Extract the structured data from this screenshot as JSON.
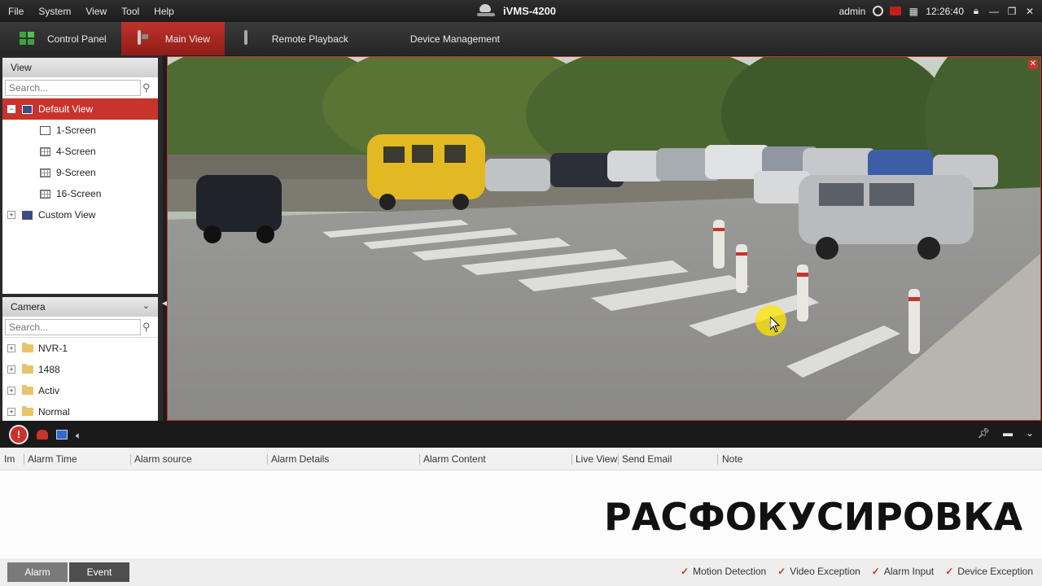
{
  "menu": {
    "items": [
      "File",
      "System",
      "View",
      "Tool",
      "Help"
    ]
  },
  "app": {
    "title": "iVMS-4200"
  },
  "tray": {
    "user": "admin",
    "time": "12:26:40"
  },
  "tabs": [
    {
      "label": "Control Panel",
      "icon": "control-panel-icon",
      "active": false
    },
    {
      "label": "Main View",
      "icon": "main-view-icon",
      "active": true
    },
    {
      "label": "Remote Playback",
      "icon": "remote-playback-icon",
      "active": false
    },
    {
      "label": "Device Management",
      "icon": "device-management-icon",
      "active": false
    }
  ],
  "view_panel": {
    "title": "View",
    "search_placeholder": "Search...",
    "tree": {
      "default_view": "Default View",
      "children": [
        "1-Screen",
        "4-Screen",
        "9-Screen",
        "16-Screen"
      ],
      "custom_view": "Custom View"
    }
  },
  "camera_panel": {
    "title": "Camera",
    "search_placeholder": "Search...",
    "items": [
      "NVR-1",
      "1488",
      "Activ",
      "Normal"
    ]
  },
  "alarm_table": {
    "columns": [
      "Im",
      "Alarm Time",
      "Alarm source",
      "Alarm Details",
      "Alarm Content",
      "Live View",
      "Send Email",
      "Note"
    ]
  },
  "overlay": {
    "caption": "РАСФОКУСИРОВКА"
  },
  "bottom": {
    "tabs": [
      "Alarm",
      "Event"
    ],
    "checks": [
      "Motion Detection",
      "Video Exception",
      "Alarm Input",
      "Device Exception"
    ]
  },
  "colors": {
    "accent": "#c8332b",
    "toolbar": "#2b2b2b"
  }
}
